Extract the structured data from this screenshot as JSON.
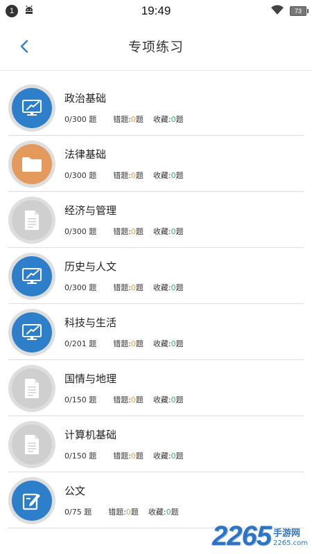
{
  "status_bar": {
    "notification_count": "1",
    "time": "19:49",
    "battery": "73"
  },
  "header": {
    "title": "专项练习"
  },
  "items": [
    {
      "title": "政治基础",
      "progress": "0/300 题",
      "wrong_label": "错题:",
      "wrong_count": "0",
      "wrong_unit": "题",
      "fav_label": "收藏:",
      "fav_count": "0",
      "fav_unit": "题",
      "icon": "monitor-icon",
      "color": "#2d7fc9"
    },
    {
      "title": "法律基础",
      "progress": "0/300 题",
      "wrong_label": "错题:",
      "wrong_count": "0",
      "wrong_unit": "题",
      "fav_label": "收藏:",
      "fav_count": "0",
      "fav_unit": "题",
      "icon": "folder-icon",
      "color": "#e49a5c"
    },
    {
      "title": "经济与管理",
      "progress": "0/300 题",
      "wrong_label": "错题:",
      "wrong_count": "0",
      "wrong_unit": "题",
      "fav_label": "收藏:",
      "fav_count": "0",
      "fav_unit": "题",
      "icon": "document-icon",
      "color": "#cfcfcf"
    },
    {
      "title": "历史与人文",
      "progress": "0/300 题",
      "wrong_label": "错题:",
      "wrong_count": "0",
      "wrong_unit": "题",
      "fav_label": "收藏:",
      "fav_count": "0",
      "fav_unit": "题",
      "icon": "monitor-icon",
      "color": "#2d7fc9"
    },
    {
      "title": "科技与生活",
      "progress": "0/201 题",
      "wrong_label": "错题:",
      "wrong_count": "0",
      "wrong_unit": "题",
      "fav_label": "收藏:",
      "fav_count": "0",
      "fav_unit": "题",
      "icon": "monitor-icon",
      "color": "#2d7fc9"
    },
    {
      "title": "国情与地理",
      "progress": "0/150 题",
      "wrong_label": "错题:",
      "wrong_count": "0",
      "wrong_unit": "题",
      "fav_label": "收藏:",
      "fav_count": "0",
      "fav_unit": "题",
      "icon": "document-icon",
      "color": "#cfcfcf"
    },
    {
      "title": "计算机基础",
      "progress": "0/150 题",
      "wrong_label": "错题:",
      "wrong_count": "0",
      "wrong_unit": "题",
      "fav_label": "收藏:",
      "fav_count": "0",
      "fav_unit": "题",
      "icon": "document-icon",
      "color": "#cfcfcf"
    },
    {
      "title": "公文",
      "progress": "0/75 题",
      "wrong_label": "错题:",
      "wrong_count": "0",
      "wrong_unit": "题",
      "fav_label": "收藏:",
      "fav_count": "0",
      "fav_unit": "题",
      "icon": "edit-icon",
      "color": "#2d7fc9"
    }
  ],
  "watermark": {
    "number": "2265",
    "cn": "手游网",
    "domain": "2265.com"
  }
}
